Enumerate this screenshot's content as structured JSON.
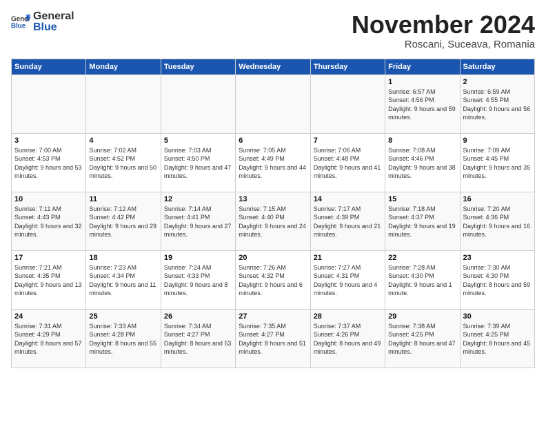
{
  "header": {
    "logo_general": "General",
    "logo_blue": "Blue",
    "month_title": "November 2024",
    "subtitle": "Roscani, Suceava, Romania"
  },
  "days_of_week": [
    "Sunday",
    "Monday",
    "Tuesday",
    "Wednesday",
    "Thursday",
    "Friday",
    "Saturday"
  ],
  "weeks": [
    [
      {
        "day": "",
        "info": ""
      },
      {
        "day": "",
        "info": ""
      },
      {
        "day": "",
        "info": ""
      },
      {
        "day": "",
        "info": ""
      },
      {
        "day": "",
        "info": ""
      },
      {
        "day": "1",
        "info": "Sunrise: 6:57 AM\nSunset: 4:56 PM\nDaylight: 9 hours and 59 minutes."
      },
      {
        "day": "2",
        "info": "Sunrise: 6:59 AM\nSunset: 4:55 PM\nDaylight: 9 hours and 56 minutes."
      }
    ],
    [
      {
        "day": "3",
        "info": "Sunrise: 7:00 AM\nSunset: 4:53 PM\nDaylight: 9 hours and 53 minutes."
      },
      {
        "day": "4",
        "info": "Sunrise: 7:02 AM\nSunset: 4:52 PM\nDaylight: 9 hours and 50 minutes."
      },
      {
        "day": "5",
        "info": "Sunrise: 7:03 AM\nSunset: 4:50 PM\nDaylight: 9 hours and 47 minutes."
      },
      {
        "day": "6",
        "info": "Sunrise: 7:05 AM\nSunset: 4:49 PM\nDaylight: 9 hours and 44 minutes."
      },
      {
        "day": "7",
        "info": "Sunrise: 7:06 AM\nSunset: 4:48 PM\nDaylight: 9 hours and 41 minutes."
      },
      {
        "day": "8",
        "info": "Sunrise: 7:08 AM\nSunset: 4:46 PM\nDaylight: 9 hours and 38 minutes."
      },
      {
        "day": "9",
        "info": "Sunrise: 7:09 AM\nSunset: 4:45 PM\nDaylight: 9 hours and 35 minutes."
      }
    ],
    [
      {
        "day": "10",
        "info": "Sunrise: 7:11 AM\nSunset: 4:43 PM\nDaylight: 9 hours and 32 minutes."
      },
      {
        "day": "11",
        "info": "Sunrise: 7:12 AM\nSunset: 4:42 PM\nDaylight: 9 hours and 29 minutes."
      },
      {
        "day": "12",
        "info": "Sunrise: 7:14 AM\nSunset: 4:41 PM\nDaylight: 9 hours and 27 minutes."
      },
      {
        "day": "13",
        "info": "Sunrise: 7:15 AM\nSunset: 4:40 PM\nDaylight: 9 hours and 24 minutes."
      },
      {
        "day": "14",
        "info": "Sunrise: 7:17 AM\nSunset: 4:39 PM\nDaylight: 9 hours and 21 minutes."
      },
      {
        "day": "15",
        "info": "Sunrise: 7:18 AM\nSunset: 4:37 PM\nDaylight: 9 hours and 19 minutes."
      },
      {
        "day": "16",
        "info": "Sunrise: 7:20 AM\nSunset: 4:36 PM\nDaylight: 9 hours and 16 minutes."
      }
    ],
    [
      {
        "day": "17",
        "info": "Sunrise: 7:21 AM\nSunset: 4:35 PM\nDaylight: 9 hours and 13 minutes."
      },
      {
        "day": "18",
        "info": "Sunrise: 7:23 AM\nSunset: 4:34 PM\nDaylight: 9 hours and 11 minutes."
      },
      {
        "day": "19",
        "info": "Sunrise: 7:24 AM\nSunset: 4:33 PM\nDaylight: 9 hours and 8 minutes."
      },
      {
        "day": "20",
        "info": "Sunrise: 7:26 AM\nSunset: 4:32 PM\nDaylight: 9 hours and 6 minutes."
      },
      {
        "day": "21",
        "info": "Sunrise: 7:27 AM\nSunset: 4:31 PM\nDaylight: 9 hours and 4 minutes."
      },
      {
        "day": "22",
        "info": "Sunrise: 7:28 AM\nSunset: 4:30 PM\nDaylight: 9 hours and 1 minute."
      },
      {
        "day": "23",
        "info": "Sunrise: 7:30 AM\nSunset: 4:30 PM\nDaylight: 8 hours and 59 minutes."
      }
    ],
    [
      {
        "day": "24",
        "info": "Sunrise: 7:31 AM\nSunset: 4:29 PM\nDaylight: 8 hours and 57 minutes."
      },
      {
        "day": "25",
        "info": "Sunrise: 7:33 AM\nSunset: 4:28 PM\nDaylight: 8 hours and 55 minutes."
      },
      {
        "day": "26",
        "info": "Sunrise: 7:34 AM\nSunset: 4:27 PM\nDaylight: 8 hours and 53 minutes."
      },
      {
        "day": "27",
        "info": "Sunrise: 7:35 AM\nSunset: 4:27 PM\nDaylight: 8 hours and 51 minutes."
      },
      {
        "day": "28",
        "info": "Sunrise: 7:37 AM\nSunset: 4:26 PM\nDaylight: 8 hours and 49 minutes."
      },
      {
        "day": "29",
        "info": "Sunrise: 7:38 AM\nSunset: 4:25 PM\nDaylight: 8 hours and 47 minutes."
      },
      {
        "day": "30",
        "info": "Sunrise: 7:39 AM\nSunset: 4:25 PM\nDaylight: 8 hours and 45 minutes."
      }
    ]
  ]
}
